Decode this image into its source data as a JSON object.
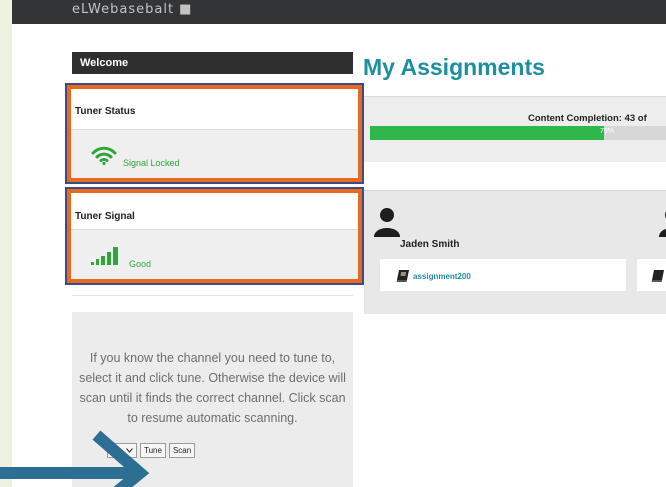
{
  "header": {
    "brand_text": "eLWebasebalt ■"
  },
  "sidebar": {
    "welcome_title": "Welcome",
    "tuner_status": {
      "title": "Tuner Status",
      "value": "Signal Locked",
      "icon": "wifi-icon"
    },
    "tuner_signal": {
      "title": "Tuner Signal",
      "value": "Good",
      "icon": "signal-bars-icon"
    },
    "scan_instructions": "If you know the channel you need to tune to, select it and click tune. Otherwise the device will scan until it finds the correct channel. Click scan to resume automatic scanning.",
    "channel_select_value": "29",
    "tune_label": "Tune",
    "scan_label": "Scan"
  },
  "main": {
    "title": "My Assignments",
    "progress": {
      "label": "Content Completion: 43 of",
      "percent_text": "79%",
      "fraction": 0.79,
      "color": "#2fb849"
    },
    "students": [
      {
        "name": "Jaden Smith",
        "assignment": "assignment200"
      }
    ]
  },
  "colors": {
    "accent": "#1d8fa0",
    "highlight_border": "#e86a1e",
    "highlight_outline": "#3a4a8a",
    "arrow": "#2d6e93"
  }
}
